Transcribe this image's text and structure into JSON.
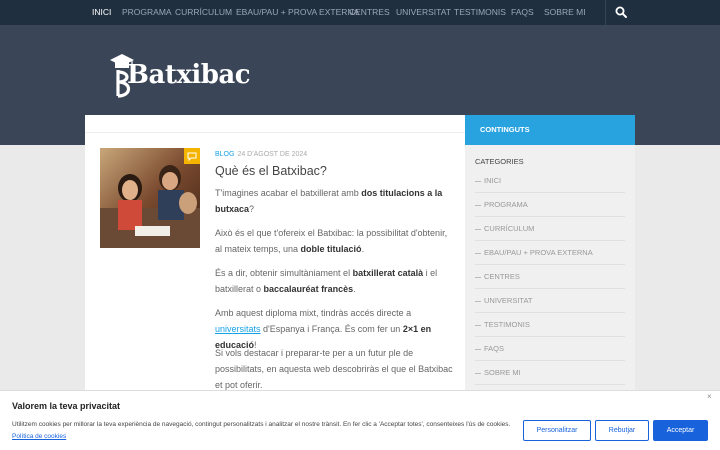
{
  "nav": {
    "items": [
      {
        "label": "INICI",
        "active": true
      },
      {
        "label": "PROGRAMA"
      },
      {
        "label": "CURRÍCULUM"
      },
      {
        "label": "EBAU/PAU + PROVA EXTERNA"
      },
      {
        "label": "CENTRES"
      },
      {
        "label": "UNIVERSITAT"
      },
      {
        "label": "TESTIMONIS"
      },
      {
        "label": "FAQS"
      },
      {
        "label": "SOBRE MI"
      }
    ],
    "search_icon": "search-icon"
  },
  "brand": {
    "name": "Batxibac",
    "logo_icon": "graduation-cap-icon"
  },
  "post": {
    "category": "BLOG",
    "date": "24 D'AGOST DE 2024",
    "comments_icon": "comment-icon",
    "title": "Què és el Batxibac?",
    "p1": {
      "a": "T'imagines acabar el batxillerat amb ",
      "b": "dos titulacions a la butxaca",
      "c": "?"
    },
    "p2": {
      "a": "Això és el que t'ofereix el Batxibac: la possibilitat d'obtenir, al mateix temps, una ",
      "b": "doble titulació",
      "c": "."
    },
    "p3": {
      "a": "És a dir, obtenir simultàniament el ",
      "b": "batxillerat català",
      "c": " i el batxillerat o ",
      "d": "baccalauréat francès",
      "e": "."
    },
    "p4": {
      "a": "Amb aquest diploma mixt, tindràs accés directe a ",
      "link": "universitats",
      "c": " d'Espanya i França. És com fer un ",
      "d": "2×1 en educació",
      "e": "!"
    },
    "p5": "Si vols destacar i preparar-te per a un futur ple de possibilitats, en aquesta web descobriràs el que el Batxibac et pot oferir."
  },
  "sidebar": {
    "header": "CONTINGUTS",
    "subheader": "CATEGORIES",
    "items": [
      "INICI",
      "PROGRAMA",
      "CURRÍCULUM",
      "EBAU/PAU + PROVA EXTERNA",
      "CENTRES",
      "UNIVERSITAT",
      "TESTIMONIS",
      "FAQS",
      "SOBRE MI"
    ]
  },
  "cookie": {
    "title": "Valorem la teva privacitat",
    "text": "Utilitzem cookies per millorar la teva experiència de navegació, contingut personalitzats i analitzar el nostre trànsit. En fer clic a 'Acceptar totes', consenteixes l'ús de cookies.",
    "policy_link": "Política de cookies",
    "customize_label": "Personalitzar",
    "reject_label": "Rebutjar",
    "accept_label": "Acceptar",
    "close_glyph": "×",
    "accent_color": "#1863dc"
  },
  "colors": {
    "nav_bg": "#1f2f3f",
    "header_bg": "#3a4657",
    "accent": "#29a3e0",
    "link": "#16a1e7"
  }
}
